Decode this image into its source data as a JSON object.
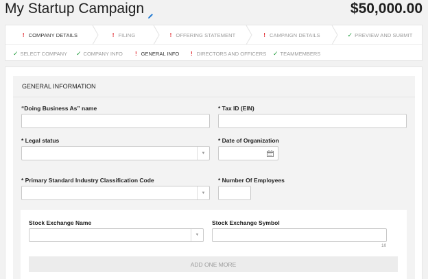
{
  "header": {
    "title": "My Startup Campaign",
    "amount": "$50,000.00"
  },
  "steps": [
    {
      "label": "Company Details",
      "status": "error",
      "active": true
    },
    {
      "label": "Filing",
      "status": "error",
      "active": false
    },
    {
      "label": "Offering Statement",
      "status": "error",
      "active": false
    },
    {
      "label": "Campaign Details",
      "status": "error",
      "active": false
    },
    {
      "label": "Preview and Submit",
      "status": "ok",
      "active": false
    }
  ],
  "substeps": [
    {
      "label": "Select Company",
      "status": "ok",
      "active": false
    },
    {
      "label": "Company Info",
      "status": "ok",
      "active": false
    },
    {
      "label": "General Info",
      "status": "error",
      "active": true
    },
    {
      "label": "Directors and Officers",
      "status": "error",
      "active": false
    },
    {
      "label": "Teammembers",
      "status": "ok",
      "active": false
    }
  ],
  "panel": {
    "title": "General Information"
  },
  "form": {
    "dba_label": "“Doing Business As” name",
    "dba_value": "",
    "tax_label": "* Tax ID (EIN)",
    "tax_value": "",
    "legal_label": "* Legal status",
    "legal_value": "",
    "date_label": "* Date of Organization",
    "date_value": "",
    "sic_label": "* Primary Standard Industry Classification Code",
    "sic_value": "",
    "employees_label": "* Number Of Employees",
    "employees_value": ""
  },
  "stock": {
    "name_label": "Stock Exchange Name",
    "name_value": "",
    "symbol_label": "Stock Exchange Symbol",
    "symbol_value": "",
    "symbol_counter": "10",
    "add_label": "Add one more"
  },
  "colors": {
    "error": "#e0242a",
    "ok": "#1f9b3a",
    "pencil": "#2a7fd4"
  }
}
